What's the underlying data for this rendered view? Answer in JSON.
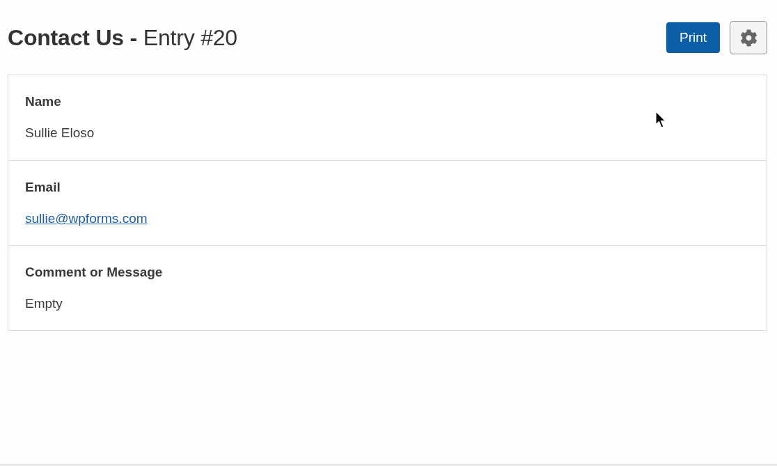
{
  "header": {
    "title": "**Contact Us -** Entry #20",
    "print_button": "Print"
  },
  "entry": {
    "fields": [
      {
        "kind": "text",
        "label": "Name",
        "value": "Sullie Eloso"
      },
      {
        "kind": "link",
        "label": "Email",
        "value": "sullie@wpforms.com"
      },
      {
        "kind": "text",
        "label": "Comment or Message",
        "value": "Empty"
      }
    ]
  }
}
